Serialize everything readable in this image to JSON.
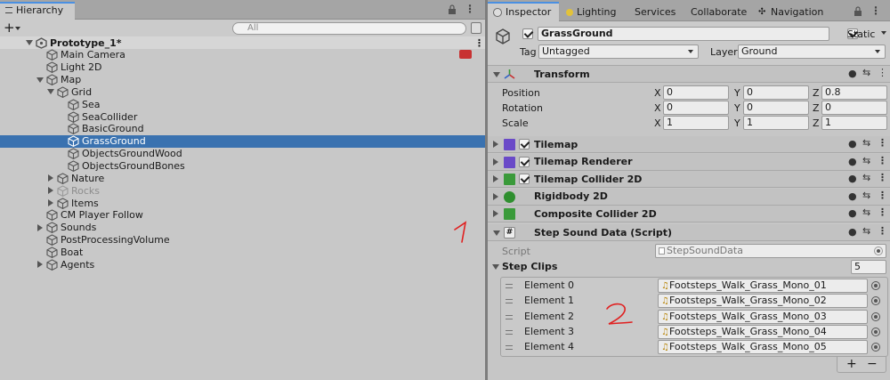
{
  "hierarchy": {
    "tab_label": "Hierarchy",
    "add_label": "+",
    "search_placeholder": "All",
    "items": [
      {
        "label": "Prototype_1*",
        "depth": 0,
        "arrow": "down",
        "icon": "unity-scene-icon",
        "scene": true
      },
      {
        "label": "Main Camera",
        "depth": 1,
        "arrow": "none",
        "icon": "cube-icon"
      },
      {
        "label": "Light 2D",
        "depth": 1,
        "arrow": "none",
        "icon": "cube-icon"
      },
      {
        "label": "Map",
        "depth": 1,
        "arrow": "down",
        "icon": "cube-icon"
      },
      {
        "label": "Grid",
        "depth": 2,
        "arrow": "down",
        "icon": "cube-icon"
      },
      {
        "label": "Sea",
        "depth": 3,
        "arrow": "none",
        "icon": "cube-icon"
      },
      {
        "label": "SeaCollider",
        "depth": 3,
        "arrow": "none",
        "icon": "cube-icon"
      },
      {
        "label": "BasicGround",
        "depth": 3,
        "arrow": "none",
        "icon": "cube-icon"
      },
      {
        "label": "GrassGround",
        "depth": 3,
        "arrow": "none",
        "icon": "cube-icon",
        "selected": true
      },
      {
        "label": "ObjectsGroundWood",
        "depth": 3,
        "arrow": "none",
        "icon": "cube-icon"
      },
      {
        "label": "ObjectsGroundBones",
        "depth": 3,
        "arrow": "none",
        "icon": "cube-icon"
      },
      {
        "label": "Nature",
        "depth": 2,
        "arrow": "right",
        "icon": "cube-icon"
      },
      {
        "label": "Rocks",
        "depth": 2,
        "arrow": "right",
        "icon": "cube-icon",
        "inactive": true
      },
      {
        "label": "Items",
        "depth": 2,
        "arrow": "right",
        "icon": "cube-icon"
      },
      {
        "label": "CM Player Follow",
        "depth": 1,
        "arrow": "none",
        "icon": "cube-icon"
      },
      {
        "label": "Sounds",
        "depth": 1,
        "arrow": "right",
        "icon": "cube-icon"
      },
      {
        "label": "PostProcessingVolume",
        "depth": 1,
        "arrow": "none",
        "icon": "cube-icon"
      },
      {
        "label": "Boat",
        "depth": 1,
        "arrow": "none",
        "icon": "cube-icon"
      },
      {
        "label": "Agents",
        "depth": 1,
        "arrow": "right",
        "icon": "cube-icon"
      }
    ],
    "annotation": "1"
  },
  "inspector": {
    "tabs": [
      "Inspector",
      "Lighting",
      "Services",
      "Collaborate",
      "Navigation"
    ],
    "object": {
      "name": "GrassGround",
      "active": true,
      "static_label": "Static",
      "static": true,
      "tag_label": "Tag",
      "tag_value": "Untagged",
      "layer_label": "Layer",
      "layer_value": "Ground"
    },
    "transform": {
      "title": "Transform",
      "position_label": "Position",
      "rotation_label": "Rotation",
      "scale_label": "Scale",
      "axis_x": "X",
      "axis_y": "Y",
      "axis_z": "Z",
      "position": [
        "0",
        "0",
        "0.8"
      ],
      "rotation": [
        "0",
        "0",
        "0"
      ],
      "scale": [
        "1",
        "1",
        "1"
      ]
    },
    "components": [
      {
        "title": "Tilemap",
        "checkbox": true,
        "icon": "tilemap-icon"
      },
      {
        "title": "Tilemap Renderer",
        "checkbox": true,
        "icon": "tilemap-renderer-icon"
      },
      {
        "title": "Tilemap Collider 2D",
        "checkbox": true,
        "icon": "tilemap-collider-icon"
      },
      {
        "title": "Rigidbody 2D",
        "checkbox": false,
        "icon": "rigidbody-icon"
      },
      {
        "title": "Composite Collider 2D",
        "checkbox": false,
        "icon": "composite-collider-icon"
      }
    ],
    "script_component": {
      "title": "Step Sound Data (Script)",
      "script_label": "Script",
      "script_value": "StepSoundData",
      "list_label": "Step Clips",
      "list_size": "5",
      "elements": [
        {
          "label": "Element 0",
          "value": "Footsteps_Walk_Grass_Mono_01"
        },
        {
          "label": "Element 1",
          "value": "Footsteps_Walk_Grass_Mono_02"
        },
        {
          "label": "Element 2",
          "value": "Footsteps_Walk_Grass_Mono_03"
        },
        {
          "label": "Element 3",
          "value": "Footsteps_Walk_Grass_Mono_04"
        },
        {
          "label": "Element 4",
          "value": "Footsteps_Walk_Grass_Mono_05"
        }
      ],
      "add_label": "+",
      "remove_label": "−"
    },
    "annotation": "2"
  },
  "colors": {
    "selection": "#3a72b0",
    "annotation": "#e02020",
    "tab_accent": "#4a90e2"
  }
}
